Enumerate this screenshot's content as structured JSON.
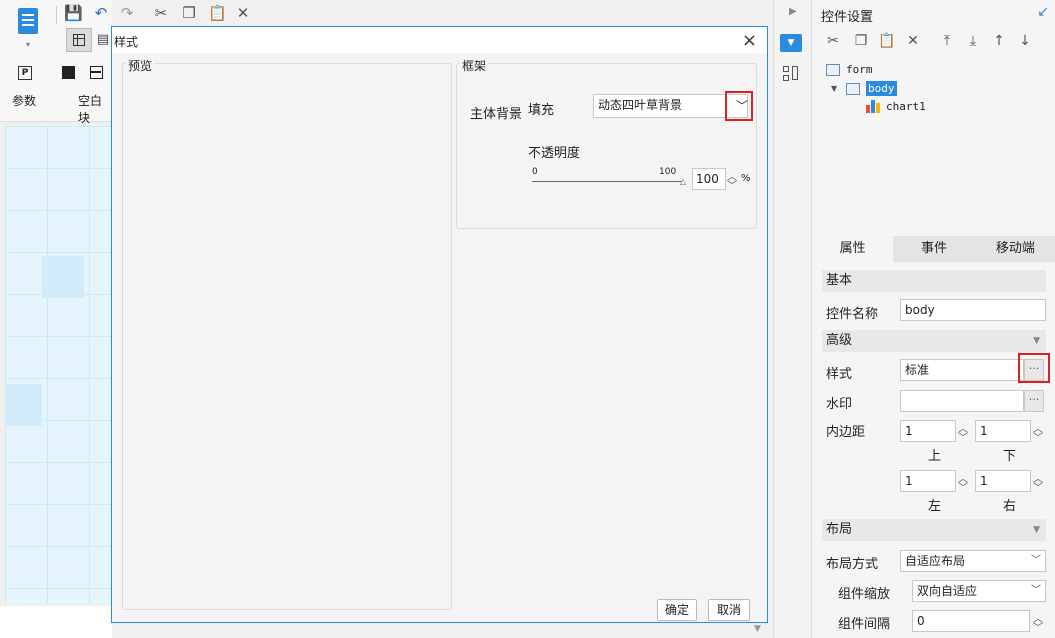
{
  "toolbar": {
    "params_label": "参数",
    "blank_block_label": "空白块"
  },
  "dialog": {
    "title": "样式",
    "preview_legend": "预览",
    "frame_legend": "框架",
    "body_bg_label": "主体背景",
    "fill_label": "填充",
    "fill_value": "动态四叶草背景",
    "opacity_label": "不透明度",
    "slider_min": "0",
    "slider_max": "100",
    "opacity_value": "100",
    "opacity_unit": "%",
    "ok_label": "确定",
    "cancel_label": "取消"
  },
  "right_panel": {
    "title": "控件设置",
    "tree": {
      "form": "form",
      "body": "body",
      "chart": "chart1"
    },
    "tabs": [
      "属性",
      "事件",
      "移动端"
    ],
    "sections": {
      "basic": "基本",
      "advanced": "高级",
      "layout": "布局"
    },
    "widget_name_label": "控件名称",
    "widget_name_value": "body",
    "style_label": "样式",
    "style_value": "标准",
    "watermark_label": "水印",
    "watermark_value": "",
    "padding_label": "内边距",
    "padding": {
      "top_value": "1",
      "top_label": "上",
      "bottom_value": "1",
      "bottom_label": "下",
      "left_value": "1",
      "left_label": "左",
      "right_value": "1",
      "right_label": "右"
    },
    "layout_mode_label": "布局方式",
    "layout_mode_value": "自适应布局",
    "scale_label": "组件缩放",
    "scale_value": "双向自适应",
    "gap_label": "组件间隔",
    "gap_value": "0",
    "dots": "···"
  },
  "colors": {
    "accent": "#2a8ae0",
    "highlight_box": "#e02020"
  }
}
